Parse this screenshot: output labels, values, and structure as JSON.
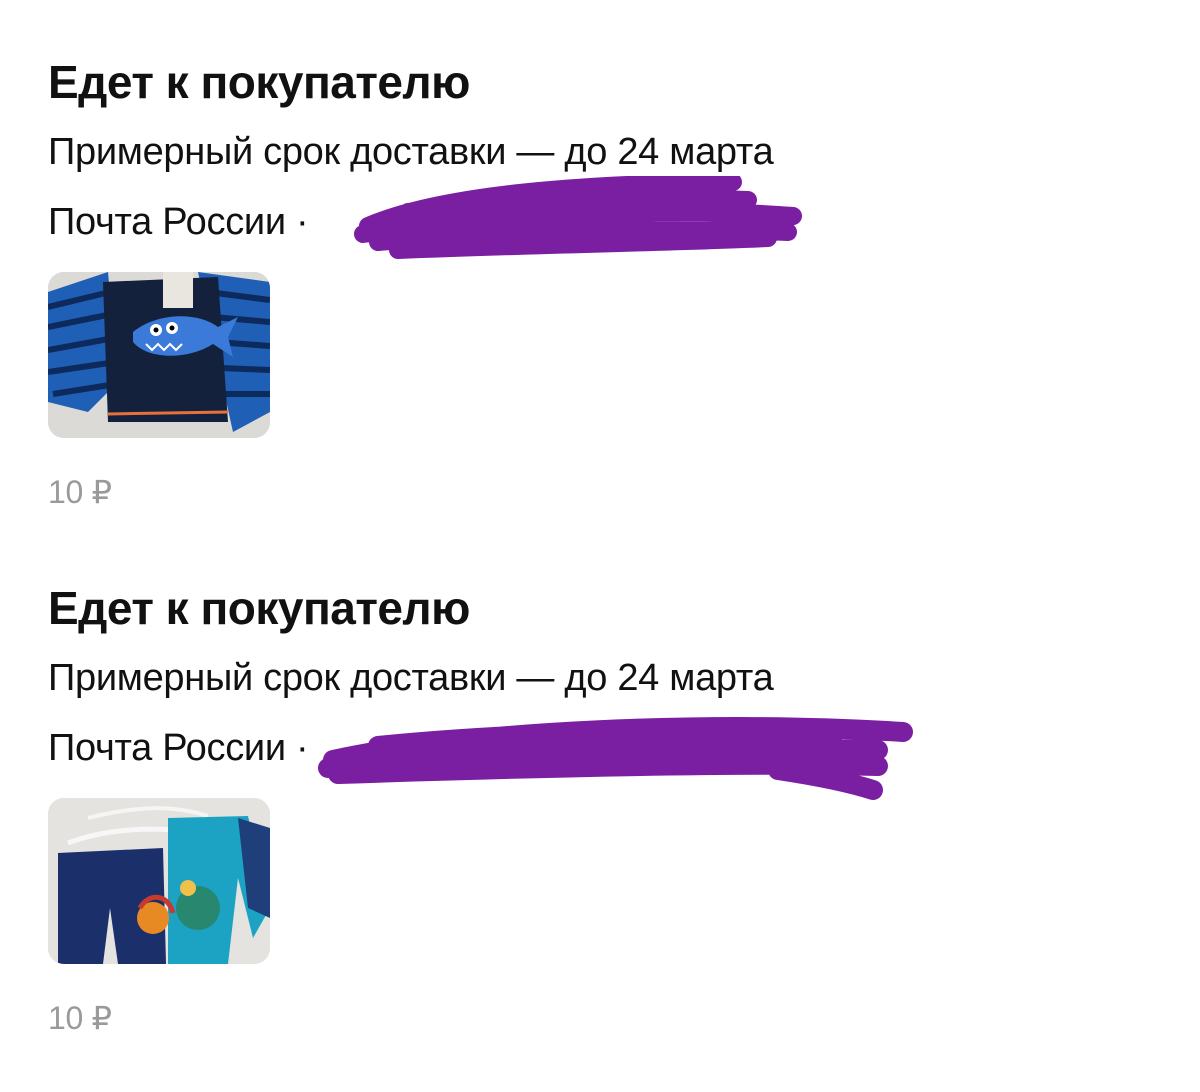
{
  "orders": [
    {
      "status": "Едет к покупателю",
      "eta": "Примерный срок доставки — до 24 марта",
      "carrier": "Почта России ·",
      "product_image": "shark-rashguard-photo",
      "price": "10 ₽"
    },
    {
      "status": "Едет к покупателю",
      "eta": "Примерный срок доставки — до 24 марта",
      "carrier": "Почта России ·",
      "product_image": "swim-set-photo",
      "price": "10 ₽"
    }
  ],
  "colors": {
    "scribble": "#7b1fa2",
    "price": "#9a9a9a",
    "text": "#111111"
  }
}
